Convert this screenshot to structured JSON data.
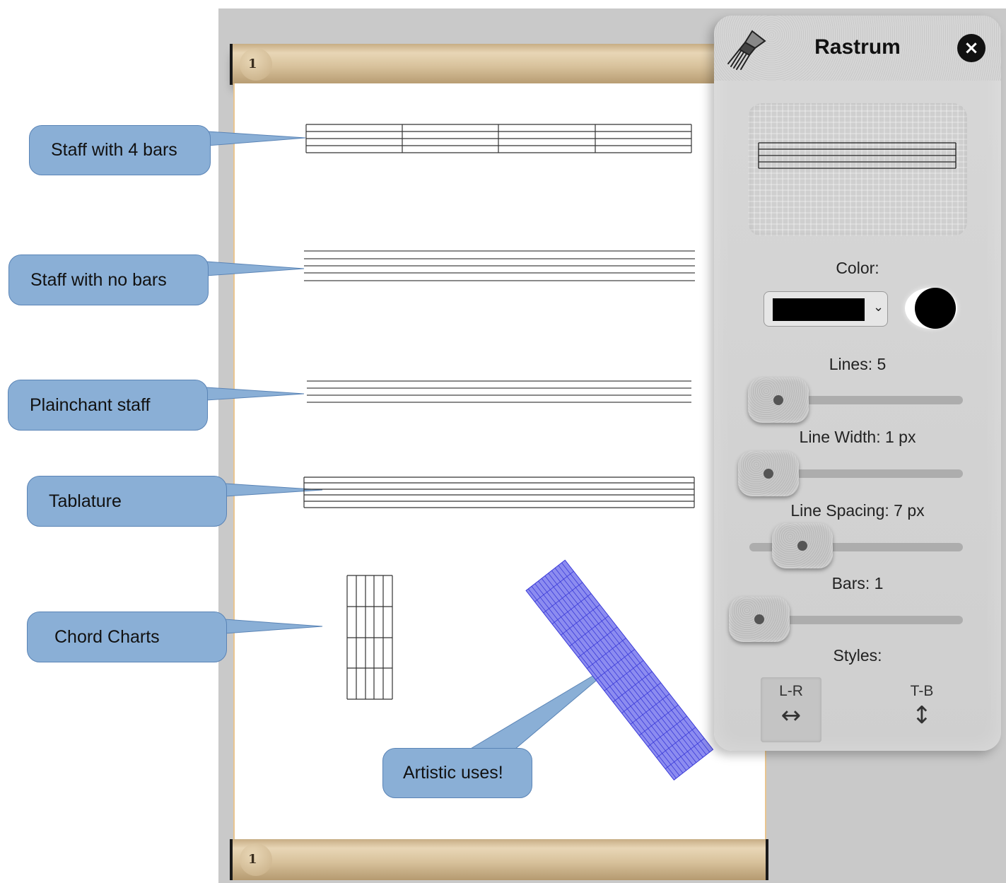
{
  "scroll": {
    "top_page_number": "1",
    "bottom_page_number": "1"
  },
  "callouts": {
    "staff_4_bars": "Staff with 4 bars",
    "staff_no_bars": "Staff with no bars",
    "plainchant": "Plainchant staff",
    "tablature": "Tablature",
    "chord_charts": "Chord Charts",
    "artistic": "Artistic uses!"
  },
  "panel": {
    "title": "Rastrum",
    "tool_icon": "rastrum-icon",
    "close_icon": "close-icon",
    "color_label": "Color:",
    "color_value": "#000000",
    "lines_label": "Lines: 5",
    "lines_value": 5,
    "line_width_label": "Line Width: 1 px",
    "line_width_value": 1,
    "line_spacing_label": "Line Spacing: 7 px",
    "line_spacing_value": 7,
    "bars_label": "Bars: 1",
    "bars_value": 1,
    "styles_label": "Styles:",
    "style_lr": "L-R",
    "style_lr_icon": "↔",
    "style_tb": "T-B",
    "style_tb_icon": "↕",
    "selected_style": "L-R"
  },
  "colors": {
    "callout_fill": "#8aafd6",
    "artistic_blue": "#4a4ae0"
  }
}
